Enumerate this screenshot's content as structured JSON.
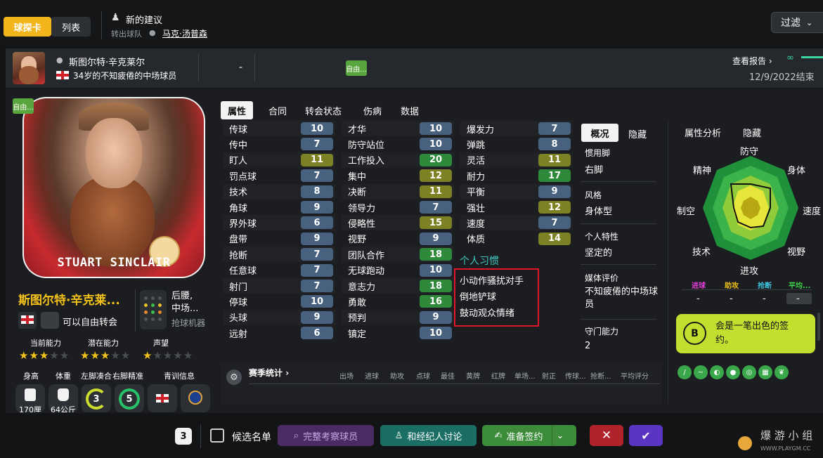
{
  "topbar": {
    "seg_card": "球探卡",
    "seg_list": "列表",
    "suggestion_title": "新的建议",
    "suggestion_from": "转出球队",
    "suggestion_name": "马克·汤普森",
    "filter_label": "过滤"
  },
  "strip": {
    "name": "斯图尔特·辛克莱尔",
    "desc": "34岁的不知疲倦的中场球员",
    "dash": "-",
    "free_tag": "自由...",
    "report_link": "查看报告",
    "report_end": "12/9/2022结束"
  },
  "card": {
    "free_tag": "自由...",
    "card_name": "STUART SINCLAIR",
    "full_name": "斯图尔特·辛克莱...",
    "transfer_status": "可以自由转会",
    "position": "后腰,",
    "position2": "中场...",
    "role": "抢球机器",
    "ca_label": "当前能力",
    "pa_label": "潜在能力",
    "rep_label": "声望",
    "ca_stars": 3,
    "pa_stars": 3,
    "rep_stars": 1,
    "height_label": "身高",
    "weight_label": "体重",
    "left_foot_label": "左脚凑合",
    "right_foot_label": "右脚精准",
    "youth_label": "青训信息",
    "height_val": "170厘",
    "weight_val": "64公斤",
    "left_foot_val": "3",
    "right_foot_val": "5",
    "colors": {
      "left_foot": "#c8dc2c",
      "right_foot": "#28c16a",
      "accent": "#f2c21a"
    }
  },
  "tabs": [
    "属性",
    "合同",
    "转会状态",
    "伤病",
    "数据"
  ],
  "attributes": {
    "col1": [
      {
        "name": "传球",
        "value": "10",
        "tier": "blue"
      },
      {
        "name": "传中",
        "value": "7",
        "tier": "blue"
      },
      {
        "name": "盯人",
        "value": "11",
        "tier": "yellow"
      },
      {
        "name": "罚点球",
        "value": "7",
        "tier": "blue"
      },
      {
        "name": "技术",
        "value": "8",
        "tier": "blue"
      },
      {
        "name": "角球",
        "value": "9",
        "tier": "blue"
      },
      {
        "name": "界外球",
        "value": "6",
        "tier": "blue"
      },
      {
        "name": "盘带",
        "value": "9",
        "tier": "blue"
      },
      {
        "name": "抢断",
        "value": "7",
        "tier": "blue"
      },
      {
        "name": "任意球",
        "value": "7",
        "tier": "blue"
      },
      {
        "name": "射门",
        "value": "7",
        "tier": "blue"
      },
      {
        "name": "停球",
        "value": "10",
        "tier": "blue"
      },
      {
        "name": "头球",
        "value": "9",
        "tier": "blue"
      },
      {
        "name": "远射",
        "value": "6",
        "tier": "blue"
      }
    ],
    "col2": [
      {
        "name": "才华",
        "value": "10",
        "tier": "blue"
      },
      {
        "name": "防守站位",
        "value": "10",
        "tier": "blue"
      },
      {
        "name": "工作投入",
        "value": "20",
        "tier": "green"
      },
      {
        "name": "集中",
        "value": "12",
        "tier": "yellow"
      },
      {
        "name": "决断",
        "value": "11",
        "tier": "yellow"
      },
      {
        "name": "领导力",
        "value": "7",
        "tier": "blue"
      },
      {
        "name": "侵略性",
        "value": "15",
        "tier": "yellow"
      },
      {
        "name": "视野",
        "value": "9",
        "tier": "blue"
      },
      {
        "name": "团队合作",
        "value": "18",
        "tier": "green"
      },
      {
        "name": "无球跑动",
        "value": "10",
        "tier": "blue"
      },
      {
        "name": "意志力",
        "value": "18",
        "tier": "green"
      },
      {
        "name": "勇敢",
        "value": "16",
        "tier": "green"
      },
      {
        "name": "预判",
        "value": "9",
        "tier": "blue"
      },
      {
        "name": "镇定",
        "value": "10",
        "tier": "blue"
      }
    ],
    "col3": [
      {
        "name": "爆发力",
        "value": "7",
        "tier": "blue"
      },
      {
        "name": "弹跳",
        "value": "8",
        "tier": "blue"
      },
      {
        "name": "灵活",
        "value": "11",
        "tier": "yellow"
      },
      {
        "name": "耐力",
        "value": "17",
        "tier": "green"
      },
      {
        "name": "平衡",
        "value": "9",
        "tier": "blue"
      },
      {
        "name": "强壮",
        "value": "12",
        "tier": "yellow"
      },
      {
        "name": "速度",
        "value": "7",
        "tier": "blue"
      },
      {
        "name": "体质",
        "value": "14",
        "tier": "yellow"
      }
    ]
  },
  "habits": {
    "title": "个人习惯",
    "items": [
      "小动作骚扰对手",
      "倒地铲球",
      "鼓动观众情绪"
    ]
  },
  "season": {
    "title": "赛季统计",
    "columns": [
      "出场",
      "进球",
      "助攻",
      "点球",
      "最佳",
      "黄牌",
      "红牌",
      "单场...",
      "射正",
      "传球...",
      "抢断...",
      "平均评分"
    ]
  },
  "overview": {
    "tab": "概况",
    "hide": "隐藏",
    "foot_label": "惯用脚",
    "foot_value": "右脚",
    "style_label": "风格",
    "style_value": "身体型",
    "traits_label": "个人特性",
    "traits_value": "坚定的",
    "media_label": "媒体评价",
    "media_value": "不知疲倦的中场球员",
    "gk_label": "守门能力",
    "gk_value": "2"
  },
  "analysis": {
    "title": "属性分析",
    "hide": "隐藏",
    "labels": [
      "防守",
      "身体",
      "速度",
      "视野",
      "进攻",
      "技术",
      "制空",
      "精神"
    ],
    "mini": [
      {
        "label": "进球",
        "value": "-",
        "color": "#e041d8"
      },
      {
        "label": "助攻",
        "value": "-",
        "color": "#f2c21a"
      },
      {
        "label": "抢断",
        "value": "-",
        "color": "#3ec6e0"
      },
      {
        "label": "平均...",
        "value": "-",
        "color": "#3ed64a"
      }
    ],
    "sign_grade": "B",
    "sign_text": "会是一笔出色的签约。"
  },
  "bottom": {
    "count": "3",
    "shortlist": "候选名单",
    "scout": "完整考察球员",
    "agent": "和经纪人讨论",
    "sign": "准备签约"
  }
}
